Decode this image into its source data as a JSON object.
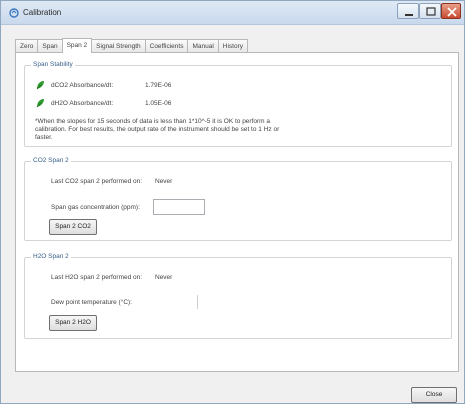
{
  "window": {
    "title": "Calibration"
  },
  "tabs": [
    {
      "label": "Zero"
    },
    {
      "label": "Span"
    },
    {
      "label": "Span 2"
    },
    {
      "label": "Signal Strength"
    },
    {
      "label": "Coefficients"
    },
    {
      "label": "Manual"
    },
    {
      "label": "History"
    }
  ],
  "active_tab": "Span 2",
  "span_stability": {
    "title": "Span Stability",
    "co2": {
      "label": "dCO2 Absorbance/dt:",
      "value": "1.79E-06"
    },
    "h2o": {
      "label": "dH2O Absorbance/dt:",
      "value": "1.05E-06"
    },
    "note": "*When the slopes for 15 seconds of data is less than 1*10^-5 it is OK to perform a calibration. For best results, the output rate of the instrument should be set to 1 Hz or faster."
  },
  "co2_span2": {
    "title": "CO2 Span 2",
    "last_performed_label": "Last CO2 span 2 performed on:",
    "last_performed_value": "Never",
    "conc_label": "Span gas concentration (ppm):",
    "conc_value": "",
    "button_label": "Span 2 CO2"
  },
  "h2o_span2": {
    "title": "H2O Span 2",
    "last_performed_label": "Last H2O span 2 performed on:",
    "last_performed_value": "Never",
    "dewpoint_label": "Dew point temperature (°C):",
    "dewpoint_value": "",
    "button_label": "Span 2 H2O"
  },
  "footer": {
    "close_label": "Close"
  },
  "colors": {
    "leaf_icon": "#2f9a2f",
    "group_title": "#3a5f8a",
    "close_button": "#c64a30"
  },
  "icons": {
    "app": "calibration-app-icon",
    "stability": "leaf-icon"
  }
}
